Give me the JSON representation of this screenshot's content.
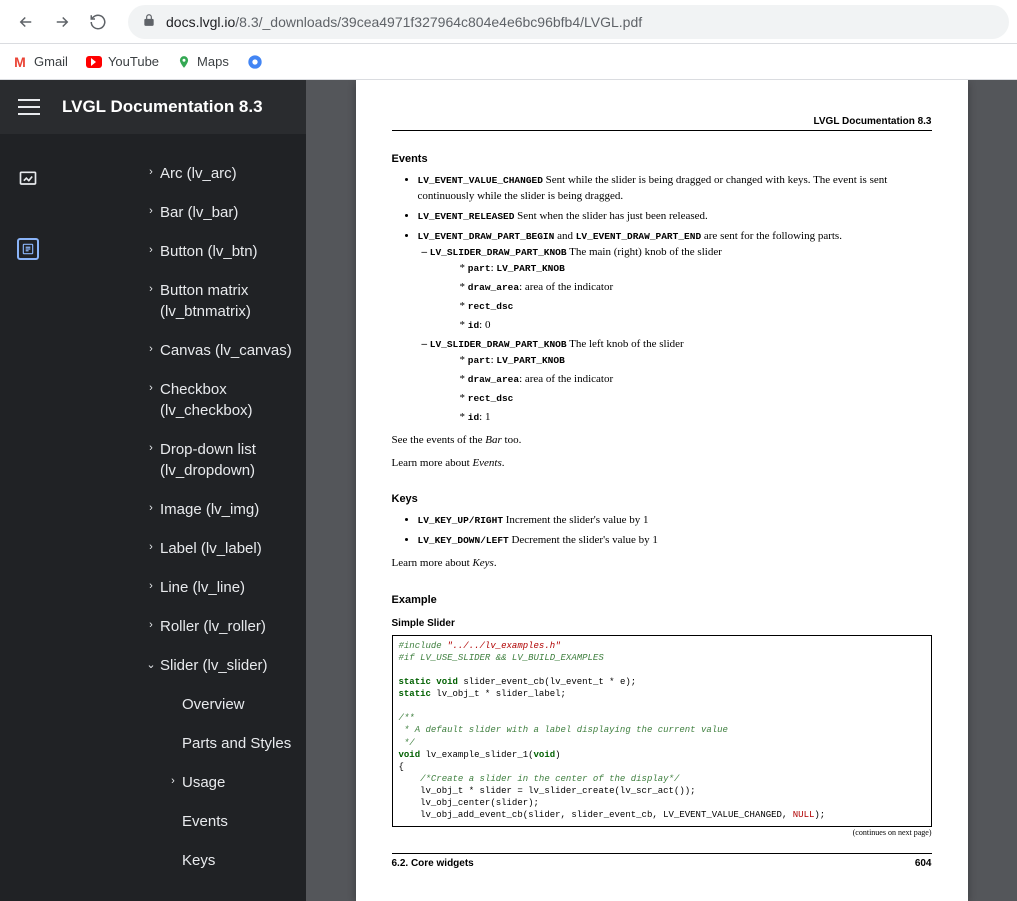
{
  "browser": {
    "url_host": "docs.lvgl.io",
    "url_path": "/8.3/_downloads/39cea4971f327964c804e4e6bc96bfb4/LVGL.pdf"
  },
  "bookmarks": [
    {
      "label": "Gmail",
      "icon": "gmail"
    },
    {
      "label": "YouTube",
      "icon": "youtube"
    },
    {
      "label": "Maps",
      "icon": "maps"
    }
  ],
  "sidebar": {
    "title": "LVGL Documentation 8.3",
    "items": [
      {
        "label": "Arc (lv_arc)",
        "expand": "right",
        "level": 1
      },
      {
        "label": "Bar (lv_bar)",
        "expand": "right",
        "level": 1
      },
      {
        "label": "Button (lv_btn)",
        "expand": "right",
        "level": 1
      },
      {
        "label": "Button matrix (lv_btnmatrix)",
        "expand": "right",
        "level": 1
      },
      {
        "label": "Canvas (lv_canvas)",
        "expand": "right",
        "level": 1
      },
      {
        "label": "Checkbox (lv_checkbox)",
        "expand": "right",
        "level": 1
      },
      {
        "label": "Drop-down list (lv_dropdown)",
        "expand": "right",
        "level": 1
      },
      {
        "label": "Image (lv_img)",
        "expand": "right",
        "level": 1
      },
      {
        "label": "Label (lv_label)",
        "expand": "right",
        "level": 1
      },
      {
        "label": "Line (lv_line)",
        "expand": "right",
        "level": 1
      },
      {
        "label": "Roller (lv_roller)",
        "expand": "right",
        "level": 1
      },
      {
        "label": "Slider (lv_slider)",
        "expand": "down",
        "level": 1
      },
      {
        "label": "Overview",
        "expand": "",
        "level": 2
      },
      {
        "label": "Parts and Styles",
        "expand": "",
        "level": 2
      },
      {
        "label": "Usage",
        "expand": "right",
        "level": 2
      },
      {
        "label": "Events",
        "expand": "",
        "level": 2
      },
      {
        "label": "Keys",
        "expand": "",
        "level": 2
      }
    ]
  },
  "doc": {
    "header": "LVGL Documentation 8.3",
    "events_heading": "Events",
    "ev_value_changed_code": "LV_EVENT_VALUE_CHANGED",
    "ev_value_changed_text": " Sent while the slider is being dragged or changed with keys.  The event is sent continuously while the slider is being dragged.",
    "ev_released_code": "LV_EVENT_RELEASED",
    "ev_released_text": " Sent when the slider has just been released.",
    "ev_draw_begin_code": "LV_EVENT_DRAW_PART_BEGIN",
    "ev_and": " and ",
    "ev_draw_end_code": "LV_EVENT_DRAW_PART_END",
    "ev_draw_text": " are sent for the following parts.",
    "knob1_code": "LV_SLIDER_DRAW_PART_KNOB",
    "knob1_text": " The main (right) knob of the slider",
    "knob2_code": "LV_SLIDER_DRAW_PART_KNOB",
    "knob2_text": " The left knob of the slider",
    "k_part": "part",
    "k_part_v": "LV_PART_KNOB",
    "k_draw": "draw_area",
    "k_draw_v": ": area of the indicator",
    "k_rect": "rect_dsc",
    "k_id": "id",
    "k_id0": ": 0",
    "k_id1": ": 1",
    "see_bar_pre": "See the events of the ",
    "bar_italic": "Bar",
    "see_bar_post": " too.",
    "learn_events_pre": "Learn more about ",
    "events_italic": "Events",
    "period": ".",
    "keys_heading": "Keys",
    "key_up_code": "LV_KEY_UP/RIGHT",
    "key_up_text": " Increment the slider's value by 1",
    "key_down_code": "LV_KEY_DOWN/LEFT",
    "key_down_text": " Decrement the slider's value by 1",
    "learn_keys_pre": "Learn more about ",
    "keys_italic": "Keys",
    "example_heading": "Example",
    "simple_slider": "Simple Slider",
    "continues": "(continues on next page)",
    "footer_left": "6.2.  Core widgets",
    "footer_right": "604",
    "code": {
      "l1a": "#include ",
      "l1b": "\"../../lv_examples.h\"",
      "l2a": "#if",
      "l2b": " LV_USE_SLIDER && LV_BUILD_EXAMPLES",
      "l3a": "static void",
      "l3b": " slider_event_cb(lv_event_t * e);",
      "l4a": "static",
      "l4b": " lv_obj_t * slider_label;",
      "l5": "/**",
      "l6": " * A default slider with a label displaying the current value",
      "l7": " */",
      "l8a": "void",
      "l8b": " lv_example_slider_1(",
      "l8c": "void",
      "l8d": ")",
      "l9": "{",
      "l10": "    /*Create a slider in the center of the display*/",
      "l11": "    lv_obj_t * slider = lv_slider_create(lv_scr_act());",
      "l12": "    lv_obj_center(slider);",
      "l13a": "    lv_obj_add_event_cb(slider, slider_event_cb, LV_EVENT_VALUE_CHANGED, ",
      "l13b": "NULL",
      "l13c": ");"
    }
  }
}
